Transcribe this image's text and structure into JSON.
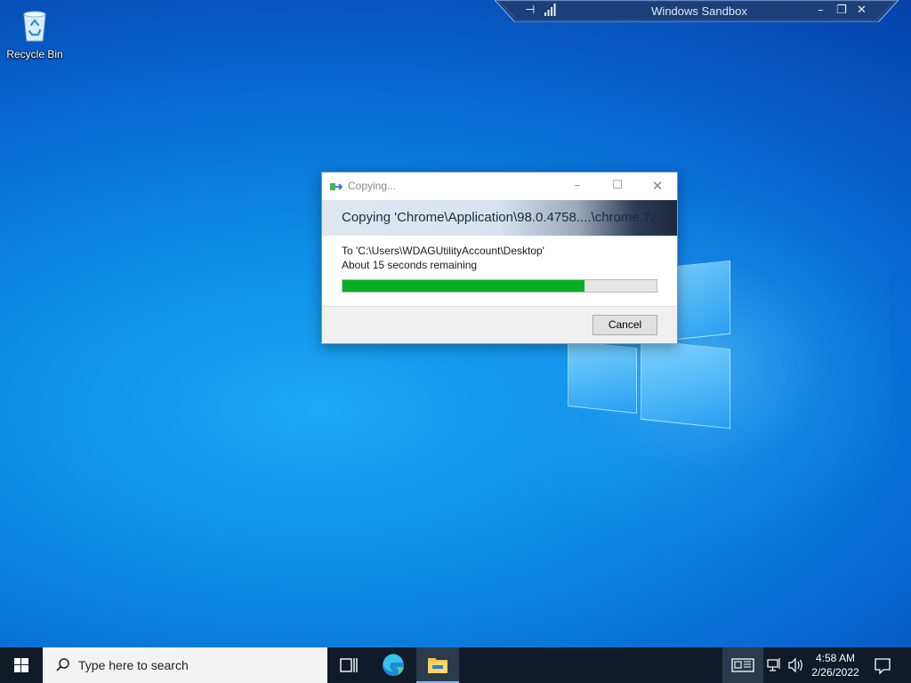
{
  "desktop": {
    "icons": [
      {
        "label": "Recycle Bin",
        "icon": "recycle-bin-icon"
      }
    ]
  },
  "sandbox_bar": {
    "title": "Windows Sandbox",
    "left_icons": [
      "pin-icon",
      "signal-icon"
    ],
    "right_icons": [
      "minimize-icon",
      "restore-icon",
      "close-icon"
    ]
  },
  "copy_dialog": {
    "title": "Copying...",
    "header": "Copying 'Chrome\\Application\\98.0.4758....\\chrome.7z",
    "destination": "To 'C:\\Users\\WDAGUtilityAccount\\Desktop'",
    "time_remaining": "About 15 seconds remaining",
    "progress_percent": 77,
    "cancel_label": "Cancel",
    "accent_color": "#06b025"
  },
  "taskbar": {
    "search_placeholder": "Type here to search",
    "pinned": [
      {
        "name": "task-view",
        "icon": "task-view-icon"
      },
      {
        "name": "edge",
        "icon": "edge-icon"
      },
      {
        "name": "file-explorer",
        "icon": "folder-icon",
        "active": true
      }
    ],
    "tray": {
      "icons": [
        "news-icon",
        "network-icon",
        "volume-icon"
      ],
      "time": "4:58 AM",
      "date": "2/26/2022",
      "notification_icon": "notification-icon"
    }
  }
}
